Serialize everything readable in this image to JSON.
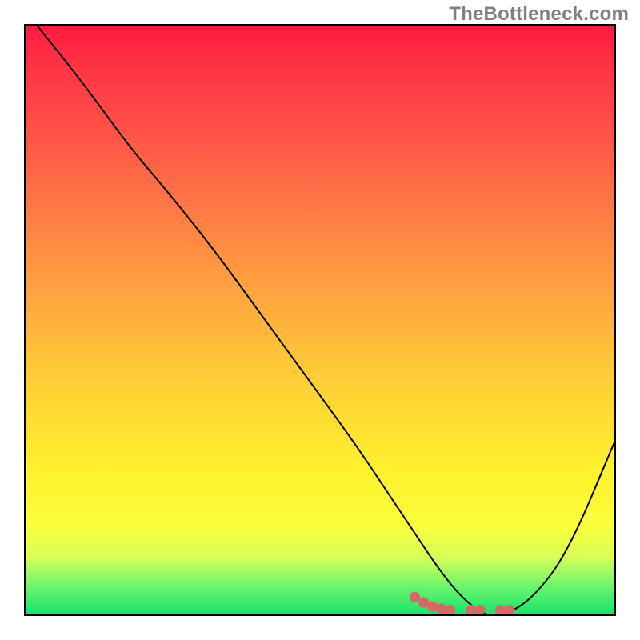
{
  "watermark": "TheBottleneck.com",
  "chart_data": {
    "type": "line",
    "title": "",
    "xlabel": "",
    "ylabel": "",
    "xlim": [
      0,
      100
    ],
    "ylim": [
      0,
      100
    ],
    "grid": false,
    "legend": false,
    "background_gradient": {
      "direction": "vertical",
      "stops": [
        {
          "pos": 0,
          "color": "#ff1a3e"
        },
        {
          "pos": 50,
          "color": "#ffc838"
        },
        {
          "pos": 85,
          "color": "#fbff3a"
        },
        {
          "pos": 100,
          "color": "#14e26c"
        }
      ]
    },
    "series": [
      {
        "name": "bottleneck-curve",
        "color": "#000000",
        "x": [
          2,
          10,
          18,
          24,
          32,
          40,
          48,
          56,
          62,
          66,
          70,
          74,
          78,
          81,
          86,
          92,
          100
        ],
        "y": [
          100,
          90,
          79,
          72,
          62,
          51,
          40,
          29,
          20,
          14,
          8,
          3,
          0,
          0,
          3,
          11,
          30
        ]
      }
    ],
    "markers": [
      {
        "name": "highlight-dots",
        "color": "#d46a66",
        "style": "round",
        "x": [
          66,
          67.5,
          69,
          70.5,
          72,
          75.5,
          77,
          80.5,
          82
        ],
        "y": [
          3.2,
          2.3,
          1.6,
          1.2,
          1.0,
          1.0,
          1.0,
          1.0,
          1.0
        ]
      }
    ]
  }
}
